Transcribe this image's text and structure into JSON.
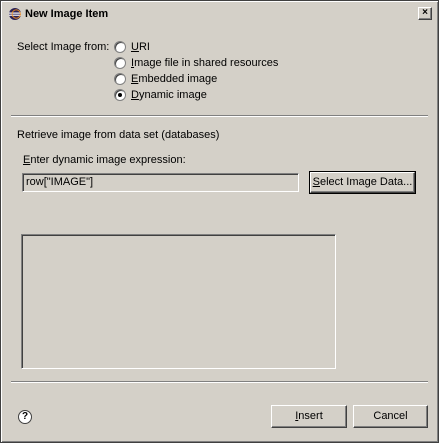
{
  "window": {
    "title": "New Image Item",
    "close_glyph": "×"
  },
  "source": {
    "label": "Select Image from:",
    "options": [
      {
        "mnemonic": "U",
        "rest": "RI",
        "selected": false
      },
      {
        "mnemonic": "I",
        "rest": "mage file in shared resources",
        "selected": false
      },
      {
        "mnemonic": "E",
        "rest": "mbedded image",
        "selected": false
      },
      {
        "mnemonic": "D",
        "rest": "ynamic image",
        "selected": true
      }
    ]
  },
  "dynamic": {
    "section_label": "Retrieve image from data set (databases)",
    "expression_label_mnemonic": "E",
    "expression_label_rest": "nter dynamic image expression:",
    "expression_value": "row[\"IMAGE\"]",
    "select_button_mnemonic": "S",
    "select_button_rest": "elect Image Data..."
  },
  "footer": {
    "help_glyph": "?",
    "insert_mnemonic": "I",
    "insert_rest": "nsert",
    "cancel_label": "Cancel"
  }
}
